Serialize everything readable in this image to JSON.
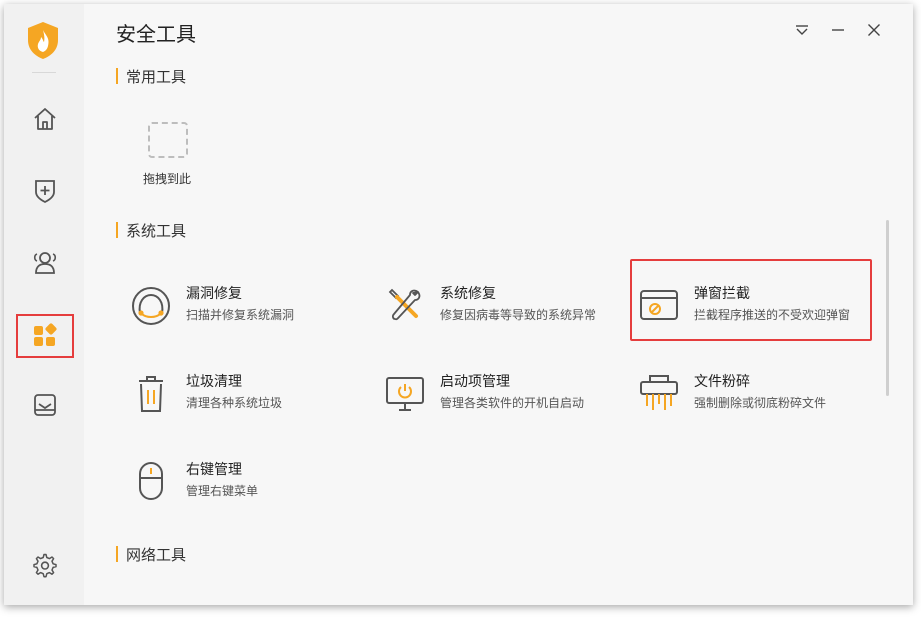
{
  "window": {
    "title": "安全工具"
  },
  "sidebar": {
    "items": [
      {
        "name": "home-icon"
      },
      {
        "name": "shield-plus-icon"
      },
      {
        "name": "users-icon"
      },
      {
        "name": "apps-icon",
        "active": true
      },
      {
        "name": "tray-icon"
      }
    ],
    "settings_icon": "gear-icon"
  },
  "sections": {
    "common": {
      "title": "常用工具",
      "drop_label": "拖拽到此"
    },
    "system": {
      "title": "系统工具",
      "tools": [
        {
          "name": "漏洞修复",
          "desc": "扫描并修复系统漏洞",
          "icon": "vulnerability-repair-icon"
        },
        {
          "name": "系统修复",
          "desc": "修复因病毒等导致的系统异常",
          "icon": "system-repair-icon"
        },
        {
          "name": "弹窗拦截",
          "desc": "拦截程序推送的不受欢迎弹窗",
          "icon": "popup-block-icon"
        },
        {
          "name": "垃圾清理",
          "desc": "清理各种系统垃圾",
          "icon": "trash-icon"
        },
        {
          "name": "启动项管理",
          "desc": "管理各类软件的开机自启动",
          "icon": "startup-monitor-icon"
        },
        {
          "name": "文件粉碎",
          "desc": "强制删除或彻底粉碎文件",
          "icon": "shredder-icon"
        },
        {
          "name": "右键管理",
          "desc": "管理右键菜单",
          "icon": "mouse-icon"
        }
      ]
    },
    "network": {
      "title": "网络工具"
    }
  },
  "colors": {
    "accent": "#f5a623",
    "highlight": "#e53d3d"
  }
}
